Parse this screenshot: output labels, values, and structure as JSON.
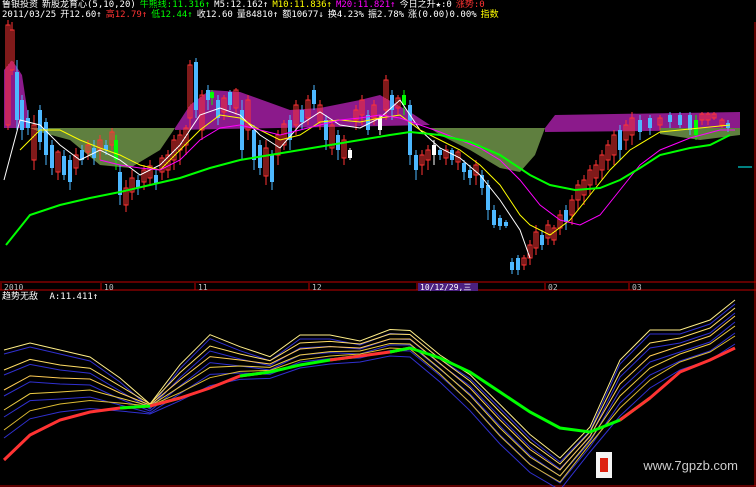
{
  "colors": {
    "red": "#ff3333",
    "cyan": "#4db8ff",
    "yellow": "#ffff00",
    "white": "#ffffff",
    "green": "#00ff00",
    "magenta": "#ff00ff",
    "purple_band": "#8b1a8b",
    "olive_band": "#5f7f3f",
    "axis_red": "#c00000"
  },
  "header": {
    "line1": [
      {
        "text": "鲁银投资",
        "color": "#ffffff"
      },
      {
        "text": "新股龙育心(5,10,20)",
        "color": "#ffffff"
      },
      {
        "text": "牛熊线:11.316↑",
        "color": "#00ff00"
      },
      {
        "text": "M5:12.162↑",
        "color": "#ffffff"
      },
      {
        "text": "M10:11.836↑",
        "color": "#ffff00"
      },
      {
        "text": "M20:11.821↑",
        "color": "#ff00ff"
      },
      {
        "text": "今日之升★:0",
        "color": "#ffffff"
      },
      {
        "text": "涨势:0",
        "color": "#ff3333"
      }
    ],
    "line2": [
      {
        "text": "2011/03/25",
        "color": "#ffffff"
      },
      {
        "text": "开12.60↑",
        "color": "#ffffff"
      },
      {
        "text": "高12.79↑",
        "color": "#ff3333"
      },
      {
        "text": "低12.44↑",
        "color": "#00ff00"
      },
      {
        "text": "收12.60",
        "color": "#ffffff"
      },
      {
        "text": "量84810↑",
        "color": "#ffffff"
      },
      {
        "text": "额10677↓",
        "color": "#ffffff"
      },
      {
        "text": "换4.23%",
        "color": "#ffffff"
      },
      {
        "text": "振2.78%",
        "color": "#ffffff"
      },
      {
        "text": "涨(0.00)0.00%",
        "color": "#ffffff"
      },
      {
        "text": "指数",
        "color": "#ffff00"
      }
    ]
  },
  "time_axis": {
    "labels": [
      "2010",
      "10",
      "11",
      "12",
      "10/12/29,三",
      "02",
      "03"
    ]
  },
  "sub_header": {
    "title": "趋势无敌",
    "value": "A:11.411↑"
  },
  "watermark": "www.7gpzb.com"
}
